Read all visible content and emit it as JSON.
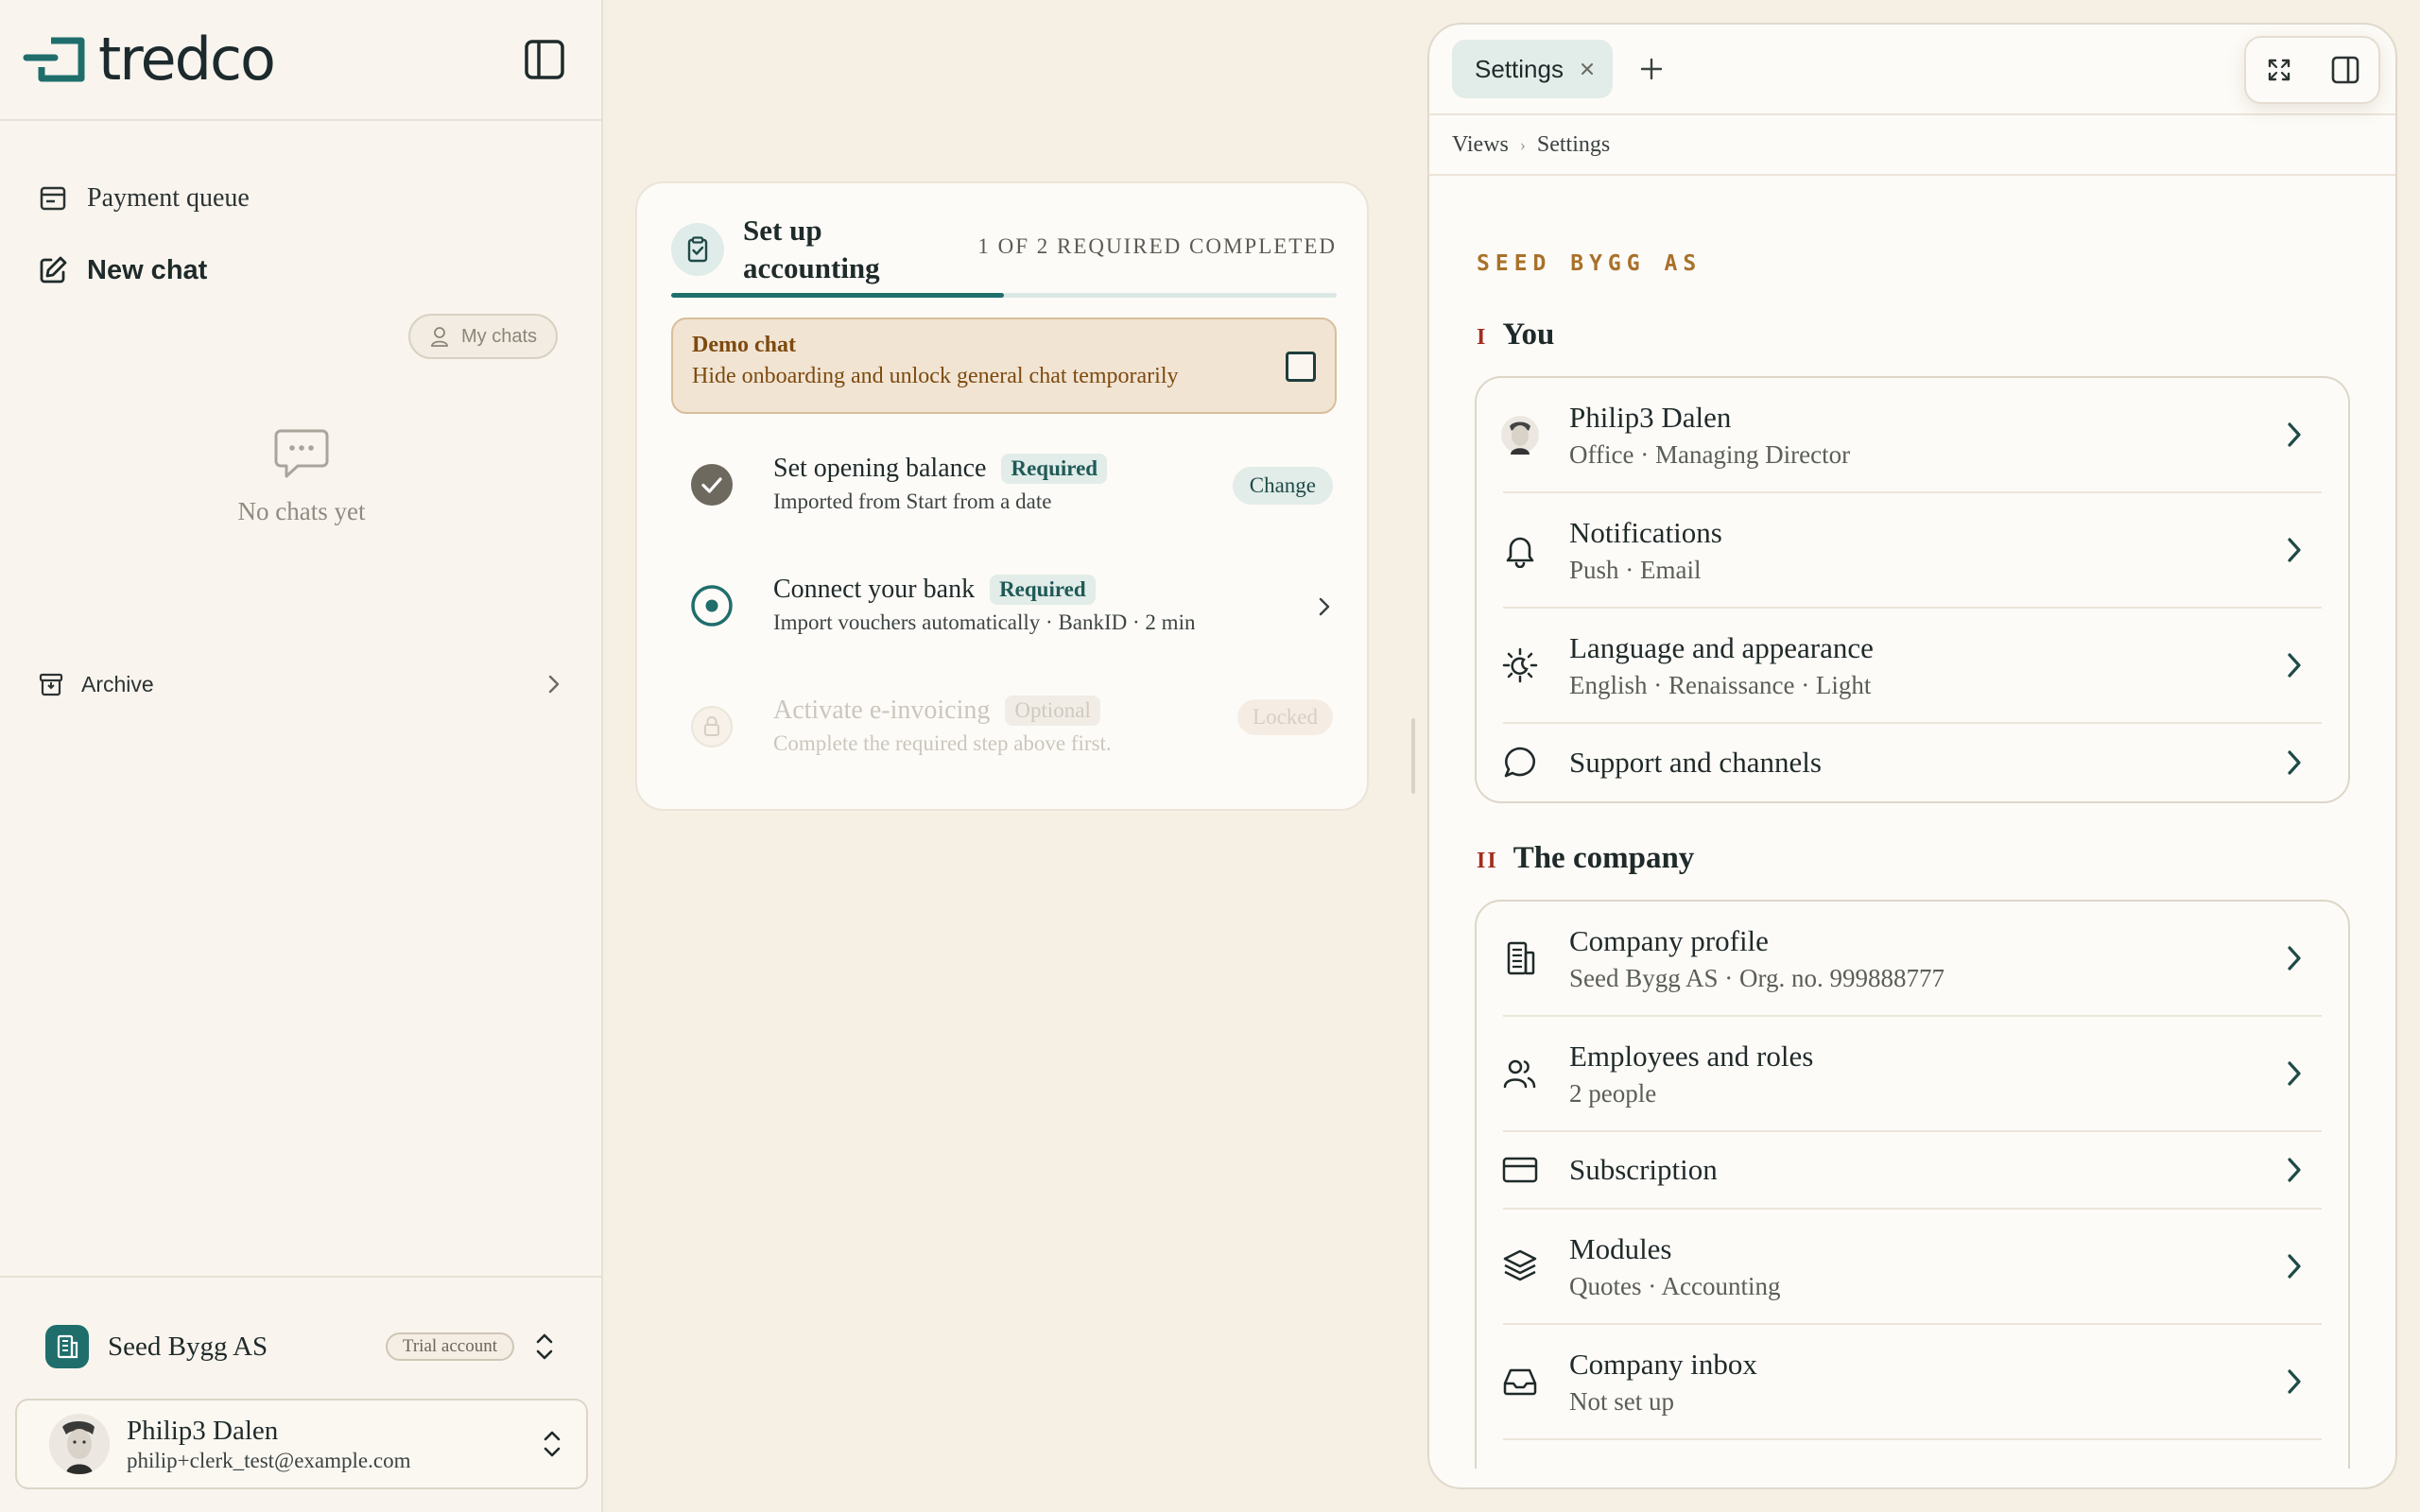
{
  "sidebar": {
    "logo_text": "tredco",
    "nav": [
      {
        "label": "Payment queue",
        "icon": "card-icon"
      },
      {
        "label": "New chat",
        "icon": "edit-icon"
      }
    ],
    "my_chats_label": "My chats",
    "empty_state": "No chats yet",
    "archive_label": "Archive",
    "company": {
      "name": "Seed Bygg AS",
      "badge": "Trial account"
    },
    "user": {
      "name": "Philip3 Dalen",
      "email": "philip+clerk_test@example.com"
    }
  },
  "onboarding": {
    "title": "Set up accounting",
    "count": "1 OF 2 REQUIRED COMPLETED",
    "progress": 0.5,
    "demo": {
      "title": "Demo chat",
      "text": "Hide onboarding and unlock general chat temporarily"
    },
    "steps": [
      {
        "title": "Set opening balance",
        "badge": "Required",
        "sub": "Imported from Start from a date",
        "action": "Change",
        "state": "done"
      },
      {
        "title": "Connect your bank",
        "badge": "Required",
        "sub": "Import vouchers automatically · BankID · 2 min",
        "state": "active"
      },
      {
        "title": "Activate e-invoicing",
        "badge": "Optional",
        "sub": "Complete the required step above first.",
        "action": "Locked",
        "state": "locked"
      }
    ]
  },
  "panel": {
    "tab_label": "Settings",
    "breadcrumb": [
      "Views",
      "Settings"
    ],
    "org_label": "SEED BYGG AS",
    "sections": [
      {
        "num": "I",
        "title": "You",
        "rows": [
          {
            "title": "Philip3 Dalen",
            "sub": "Office · Managing Director",
            "icon": "avatar-icon"
          },
          {
            "title": "Notifications",
            "sub": "Push · Email",
            "icon": "bell-icon"
          },
          {
            "title": "Language and appearance",
            "sub": "English · Renaissance · Light",
            "icon": "sun-moon-icon"
          },
          {
            "title": "Support and channels",
            "sub": "",
            "icon": "chat-bubble-icon"
          }
        ]
      },
      {
        "num": "II",
        "title": "The company",
        "rows": [
          {
            "title": "Company profile",
            "sub": "Seed Bygg AS · Org. no. 999888777",
            "icon": "building-icon"
          },
          {
            "title": "Employees and roles",
            "sub": "2 people",
            "icon": "users-icon"
          },
          {
            "title": "Subscription",
            "sub": "",
            "icon": "credit-card-icon"
          },
          {
            "title": "Modules",
            "sub": "Quotes · Accounting",
            "icon": "layers-icon"
          },
          {
            "title": "Company inbox",
            "sub": "Not set up",
            "icon": "inbox-icon"
          }
        ]
      }
    ]
  },
  "colors": {
    "accent": "#1f6e6c",
    "background": "#f5efe4",
    "warning": "#7d4a0f",
    "section_number": "#a32c20"
  }
}
